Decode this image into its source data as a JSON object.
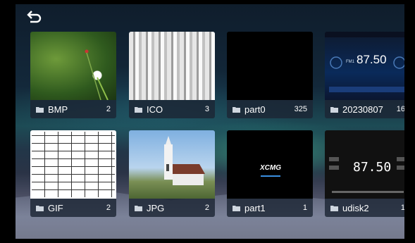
{
  "toolbar": {
    "back_icon": "back-arrow-icon"
  },
  "folders": [
    {
      "name": "BMP",
      "count": "2"
    },
    {
      "name": "ICO",
      "count": "3"
    },
    {
      "name": "part0",
      "count": "325"
    },
    {
      "name": "20230807",
      "count": "16"
    },
    {
      "name": "GIF",
      "count": "2"
    },
    {
      "name": "JPG",
      "count": "2"
    },
    {
      "name": "part1",
      "count": "1"
    },
    {
      "name": "udisk2",
      "count": "1"
    }
  ],
  "thumbnails": {
    "radio_frequency": "87.50",
    "radio_band": "FM1",
    "logo_text": "XCMG",
    "digit_frequency": "87.50"
  },
  "colors": {
    "caption_bg": "#1c2634",
    "aurora": "#46d2a0"
  }
}
